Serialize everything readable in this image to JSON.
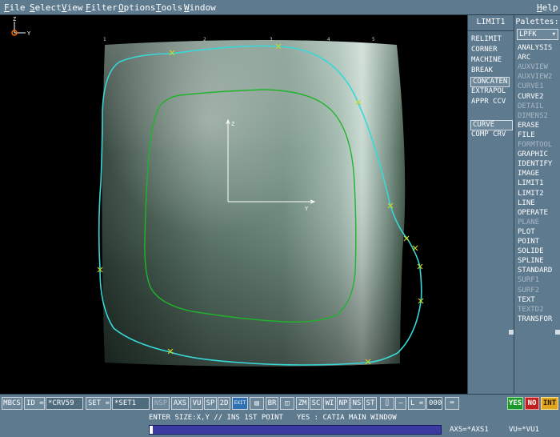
{
  "menu": [
    "File",
    "Select",
    "View",
    "Filter",
    "Options",
    "Tools",
    "Window"
  ],
  "help": "Help",
  "viewport": {
    "triad_z": "Z",
    "triad_y": "Y",
    "center_z": "Z",
    "center_y": "Y",
    "ruler_labels": [
      "1",
      "2",
      "3",
      "4",
      "5"
    ]
  },
  "command_panel": {
    "title": "LIMIT1",
    "items": [
      "RELIMIT",
      "CORNER",
      "MACHINE",
      "BREAK",
      "CONCATEN",
      "EXTRAPOL",
      "APPR CCV"
    ],
    "selected": "CONCATEN",
    "items2": [
      "CURVE",
      "COMP CRV"
    ],
    "selected2": "CURVE"
  },
  "palettes": {
    "title": "Palettes:",
    "selected": "LPFK",
    "items": [
      {
        "label": "ANALYSIS",
        "dim": false
      },
      {
        "label": "ARC",
        "dim": false
      },
      {
        "label": "AUXVIEW",
        "dim": true
      },
      {
        "label": "AUXVIEW2",
        "dim": true
      },
      {
        "label": "CURVE1",
        "dim": true
      },
      {
        "label": "CURVE2",
        "dim": false
      },
      {
        "label": "DETAIL",
        "dim": true
      },
      {
        "label": "DIMENS2",
        "dim": true
      },
      {
        "label": "ERASE",
        "dim": false
      },
      {
        "label": "FILE",
        "dim": false
      },
      {
        "label": "FORMTOOL",
        "dim": true
      },
      {
        "label": "GRAPHIC",
        "dim": false
      },
      {
        "label": "IDENTIFY",
        "dim": false
      },
      {
        "label": "IMAGE",
        "dim": false
      },
      {
        "label": "LIMIT1",
        "dim": false
      },
      {
        "label": "LIMIT2",
        "dim": false
      },
      {
        "label": "LINE",
        "dim": false
      },
      {
        "label": "OPERATE",
        "dim": false
      },
      {
        "label": "PLANE",
        "dim": true
      },
      {
        "label": "PLOT",
        "dim": false
      },
      {
        "label": "POINT",
        "dim": false
      },
      {
        "label": "SOLIDE",
        "dim": false
      },
      {
        "label": "SPLINE",
        "dim": false
      },
      {
        "label": "STANDARD",
        "dim": false
      },
      {
        "label": "SURF1",
        "dim": true
      },
      {
        "label": "SURF2",
        "dim": true
      },
      {
        "label": "TEXT",
        "dim": false
      },
      {
        "label": "TEXTD2",
        "dim": true
      },
      {
        "label": "TRANSFOR",
        "dim": false
      }
    ]
  },
  "toolbar": {
    "mbcs": "MBCS",
    "id_label": "ID",
    "id_value": "*CRV59",
    "set_label": "SET",
    "set_value": "*SET1",
    "nsp": "NSP",
    "axs": "AXS",
    "vu": "VU",
    "sp": "SP",
    "two_d": "2D",
    "exit": "EXIT",
    "br": "BR",
    "zm": "ZM",
    "sc": "SC",
    "wi": "WI",
    "np": "NP",
    "ns": "NS",
    "st": "ST",
    "l_label": "L",
    "l_value": "000",
    "yes": "YES",
    "no": "NO",
    "int": "INT"
  },
  "status": {
    "prompt": "ENTER SIZE:X,Y // INS 1ST POINT",
    "yes_hint": "YES : CATIA MAIN WINDOW",
    "axs": "AXS=*AXS1",
    "vu": "VU=*VU1",
    "progress": 0.01
  },
  "colors": {
    "panel": "#5e7a8e",
    "cyan_curve": "#39d8d8",
    "green_curve": "#1fb42a",
    "marker": "#c9d62a"
  }
}
